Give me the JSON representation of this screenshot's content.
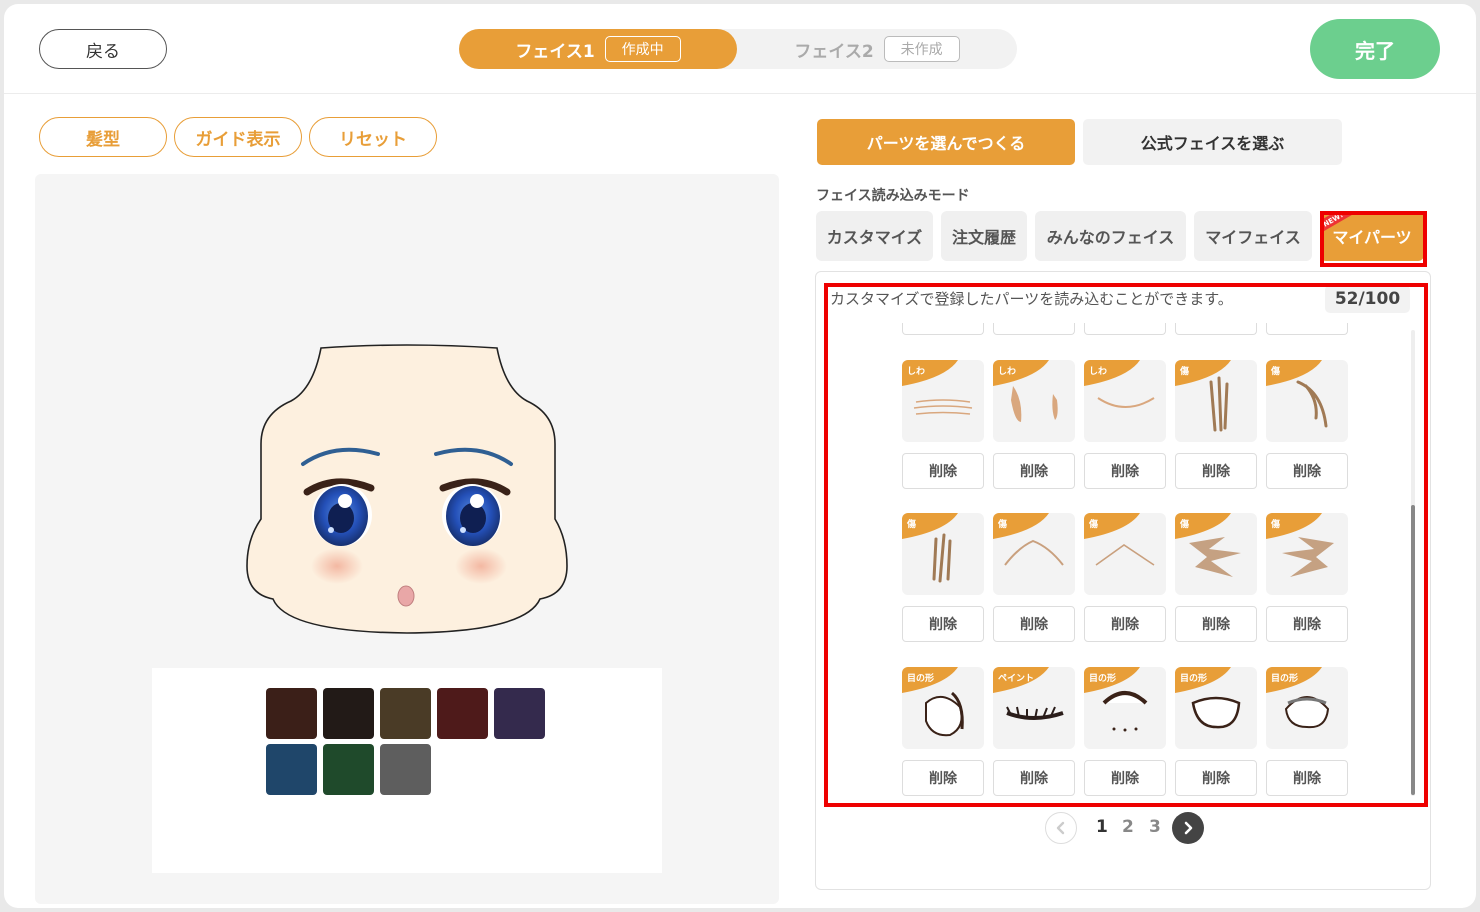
{
  "header": {
    "back_label": "戻る",
    "face_tabs": [
      {
        "label": "フェイス1",
        "badge": "作成中"
      },
      {
        "label": "フェイス2",
        "badge": "未作成"
      }
    ],
    "done_label": "完了"
  },
  "tools": {
    "hair_label": "髪型",
    "guide_label": "ガイド表示",
    "reset_label": "リセット"
  },
  "palette": {
    "colors": [
      "#3b1f18",
      "#221a17",
      "#4a3b26",
      "#4e1a1a",
      "#342a4d",
      "#1f466a",
      "#1f4a2b",
      "#5e5e5e"
    ]
  },
  "mode": {
    "make_label": "パーツを選んでつくる",
    "official_label": "公式フェイスを選ぶ",
    "load_mode_label": "フェイス読み込みモード",
    "source_tabs": [
      "カスタマイズ",
      "注文履歴",
      "みんなのフェイス",
      "マイフェイス",
      "マイパーツ"
    ],
    "new_badge": "NEW!"
  },
  "parts": {
    "description": "カスタマイズで登録したパーツを読み込むことができます。",
    "count": "52/100",
    "delete_label": "削除",
    "rows": [
      [
        "しわ",
        "しわ",
        "しわ",
        "傷",
        "傷"
      ],
      [
        "傷",
        "傷",
        "傷",
        "傷",
        "傷"
      ],
      [
        "目の形",
        "ペイント",
        "目の形",
        "目の形",
        "目の形"
      ]
    ],
    "icons": [
      [
        "wrinkle-lines-icon",
        "wrinkle-cheek-icon",
        "wrinkle-curve-icon",
        "scar-claw-icon",
        "scar-hook-icon"
      ],
      [
        "scar-slash-icon",
        "scar-chevron-icon",
        "scar-chevron-thin-icon",
        "scar-burst-icon",
        "scar-burst-right-icon"
      ],
      [
        "eye-shape-round-icon",
        "eyelash-paint-icon",
        "eye-shape-dotted-icon",
        "eye-shape-wide-icon",
        "eye-shape-lidded-icon"
      ]
    ]
  },
  "pagination": {
    "pages": [
      "1",
      "2",
      "3"
    ],
    "current": "1"
  },
  "colors": {
    "accent": "#e89e38",
    "done": "#6ccf8e",
    "highlight": "#ee0000"
  }
}
